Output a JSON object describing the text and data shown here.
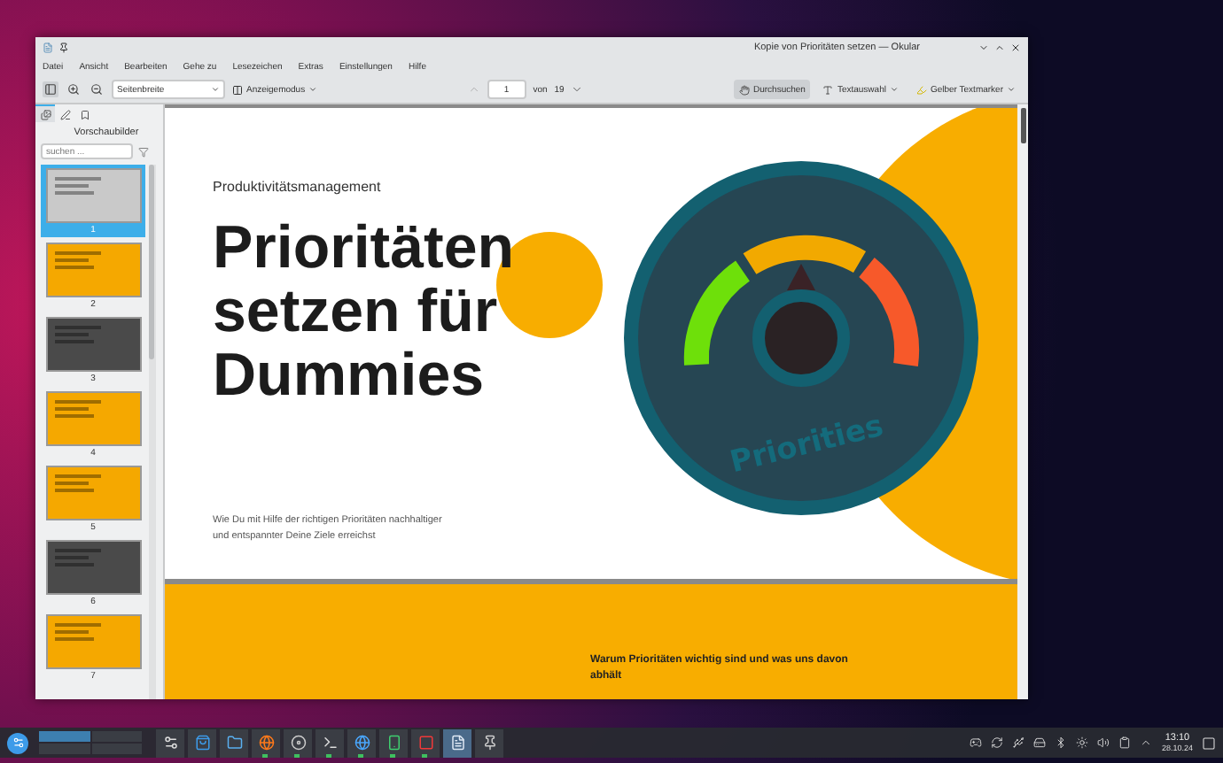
{
  "window": {
    "title": "Kopie von Prioritäten setzen — Okular"
  },
  "menu": [
    "Datei",
    "Ansicht",
    "Bearbeiten",
    "Gehe zu",
    "Lesezeichen",
    "Extras",
    "Einstellungen",
    "Hilfe"
  ],
  "toolbar": {
    "zoom_mode": "Seitenbreite",
    "view_mode": "Anzeigemodus",
    "page": "1",
    "page_of": "von",
    "page_count": "19",
    "tools": [
      {
        "kind": "browse",
        "label": "Durchsuchen",
        "selected": true
      },
      {
        "kind": "select",
        "label": "Textauswahl",
        "selected": false
      },
      {
        "kind": "highlight",
        "label": "Gelber Textmarker",
        "selected": false
      }
    ]
  },
  "sidebar": {
    "tabs": [
      {
        "kind": "thumbnails",
        "selected": true
      },
      {
        "kind": "annotations",
        "selected": false
      },
      {
        "kind": "bookmarks",
        "selected": false
      }
    ],
    "title": "Vorschaubilder",
    "search": {
      "placeholder": "suchen ..."
    },
    "thumbnails": [
      {
        "label": "1",
        "selected": true,
        "color": "#c9c9c9"
      },
      {
        "label": "2",
        "selected": false,
        "color": "#f5a800"
      },
      {
        "label": "3",
        "selected": false,
        "color": "#4a4a4a"
      },
      {
        "label": "4",
        "selected": false,
        "color": "#f5a800"
      },
      {
        "label": "5",
        "selected": false,
        "color": "#f5a800"
      },
      {
        "label": "6",
        "selected": false,
        "color": "#4a4a4a"
      },
      {
        "label": "7",
        "selected": false,
        "color": "#f5a800"
      }
    ]
  },
  "document": {
    "cover": {
      "kicker": "Produktivitätsmanagement",
      "title_lines": [
        "Prioritäten",
        "setzen für",
        "Dummies"
      ],
      "subtitle_lines": [
        "Wie Du mit Hilfe der richtigen Prioritäten nachhaltiger",
        "und entspannter Deine Ziele erreichst"
      ],
      "badge_text": "Priorities"
    },
    "next_page": {
      "text_lines": [
        "Warum Prioritäten wichtig sind und was uns davon",
        "abhält"
      ]
    }
  },
  "taskbar": {
    "apps": [
      {
        "kind": "settings",
        "running": false,
        "selected": false
      },
      {
        "kind": "store",
        "running": false,
        "selected": false
      },
      {
        "kind": "files",
        "running": false,
        "selected": false
      },
      {
        "kind": "firefox",
        "running": true,
        "selected": false
      },
      {
        "kind": "disk",
        "running": true,
        "selected": false
      },
      {
        "kind": "terminal",
        "running": true,
        "selected": false
      },
      {
        "kind": "globe",
        "running": true,
        "selected": false
      },
      {
        "kind": "phone",
        "running": true,
        "selected": false
      },
      {
        "kind": "vivaldi",
        "running": true,
        "selected": false
      },
      {
        "kind": "okular",
        "running": false,
        "selected": true
      },
      {
        "kind": "gimp",
        "running": false,
        "selected": false
      }
    ],
    "clock": "13:10",
    "date": "28.10.24"
  }
}
